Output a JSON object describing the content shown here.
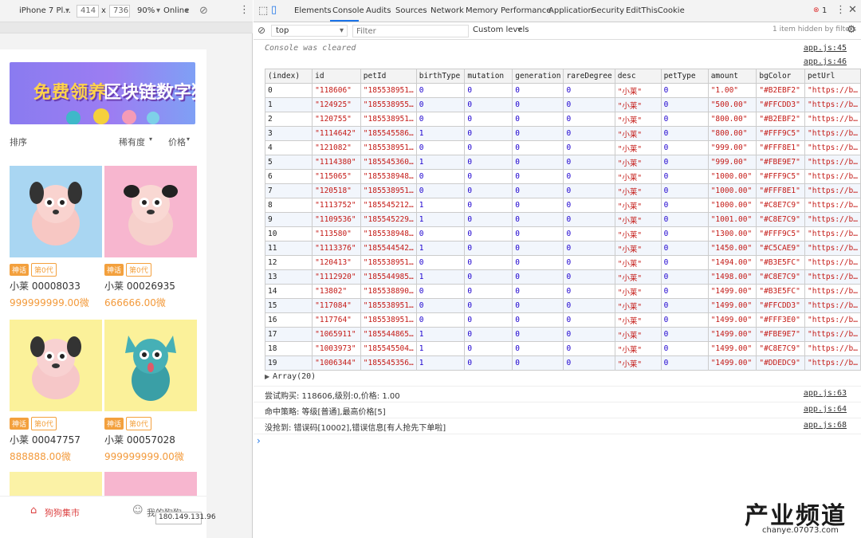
{
  "device_toolbar": {
    "device": "iPhone 7 Pl...",
    "width": "414",
    "x": "x",
    "height": "736",
    "zoom": "90%",
    "network": "Online"
  },
  "phone": {
    "banner": {
      "title_a": "免费领养",
      "title_b": "区块链数字狗"
    },
    "sort": {
      "label": "排序",
      "rarity": "稀有度",
      "price": "价格"
    },
    "cards": [
      {
        "tag1": "神话",
        "tag2": "第0代",
        "name": "小莱 00008033",
        "price": "999999999.00微",
        "bg": "#a9d6f2"
      },
      {
        "tag1": "神话",
        "tag2": "第0代",
        "name": "小莱 00026935",
        "price": "666666.00微",
        "bg": "#f7b6cf"
      },
      {
        "tag1": "神话",
        "tag2": "第0代",
        "name": "小莱 00047757",
        "price": "888888.00微",
        "bg": "#fbf19a"
      },
      {
        "tag1": "神话",
        "tag2": "第0代",
        "name": "小莱 00057028",
        "price": "999999999.00微",
        "bg": "#fbf19a"
      }
    ],
    "partial_bgs": [
      "#fbf2a6",
      "#f7b6cf"
    ],
    "nav": {
      "market": "狗狗集市",
      "mine": "我的狗狗"
    },
    "ip": "180.149.131.96"
  },
  "devtools": {
    "tabs": [
      "Elements",
      "Console",
      "Audits",
      "Sources",
      "Network",
      "Memory",
      "Performance",
      "Application",
      "Security",
      "EditThisCookie"
    ],
    "active_tab": "Console",
    "error_count": "1",
    "filter": {
      "context": "top",
      "placeholder": "Filter",
      "levels": "Custom levels",
      "hidden": "1 item hidden by filters"
    },
    "cleared": "Console was cleared",
    "cleared_src": "app.js:45",
    "table_src": "app.js:46",
    "columns": [
      "(index)",
      "id",
      "petId",
      "birthType",
      "mutation",
      "generation",
      "rareDegree",
      "desc",
      "petType",
      "amount",
      "bgColor",
      "petUrl"
    ],
    "rows": [
      [
        "0",
        "\"118606\"",
        "\"185538951…",
        "0",
        "0",
        "0",
        "0",
        "\"小莱\"",
        "0",
        "\"1.00\"",
        "\"#B2EBF2\"",
        "\"https://b…"
      ],
      [
        "1",
        "\"124925\"",
        "\"185538955…",
        "0",
        "0",
        "0",
        "0",
        "\"小莱\"",
        "0",
        "\"500.00\"",
        "\"#FFCDD3\"",
        "\"https://b…"
      ],
      [
        "2",
        "\"120755\"",
        "\"185538951…",
        "0",
        "0",
        "0",
        "0",
        "\"小莱\"",
        "0",
        "\"800.00\"",
        "\"#B2EBF2\"",
        "\"https://b…"
      ],
      [
        "3",
        "\"1114642\"",
        "\"185545586…",
        "1",
        "0",
        "0",
        "0",
        "\"小莱\"",
        "0",
        "\"800.00\"",
        "\"#FFF9C5\"",
        "\"https://b…"
      ],
      [
        "4",
        "\"121082\"",
        "\"185538951…",
        "0",
        "0",
        "0",
        "0",
        "\"小莱\"",
        "0",
        "\"999.00\"",
        "\"#FFF8E1\"",
        "\"https://b…"
      ],
      [
        "5",
        "\"1114380\"",
        "\"185545360…",
        "1",
        "0",
        "0",
        "0",
        "\"小莱\"",
        "0",
        "\"999.00\"",
        "\"#FBE9E7\"",
        "\"https://b…"
      ],
      [
        "6",
        "\"115065\"",
        "\"185538948…",
        "0",
        "0",
        "0",
        "0",
        "\"小莱\"",
        "0",
        "\"1000.00\"",
        "\"#FFF9C5\"",
        "\"https://b…"
      ],
      [
        "7",
        "\"120518\"",
        "\"185538951…",
        "0",
        "0",
        "0",
        "0",
        "\"小莱\"",
        "0",
        "\"1000.00\"",
        "\"#FFF8E1\"",
        "\"https://b…"
      ],
      [
        "8",
        "\"1113752\"",
        "\"185545212…",
        "1",
        "0",
        "0",
        "0",
        "\"小莱\"",
        "0",
        "\"1000.00\"",
        "\"#C8E7C9\"",
        "\"https://b…"
      ],
      [
        "9",
        "\"1109536\"",
        "\"185545229…",
        "1",
        "0",
        "0",
        "0",
        "\"小莱\"",
        "0",
        "\"1001.00\"",
        "\"#C8E7C9\"",
        "\"https://b…"
      ],
      [
        "10",
        "\"113580\"",
        "\"185538948…",
        "0",
        "0",
        "0",
        "0",
        "\"小莱\"",
        "0",
        "\"1300.00\"",
        "\"#FFF9C5\"",
        "\"https://b…"
      ],
      [
        "11",
        "\"1113376\"",
        "\"185544542…",
        "1",
        "0",
        "0",
        "0",
        "\"小莱\"",
        "0",
        "\"1450.00\"",
        "\"#C5CAE9\"",
        "\"https://b…"
      ],
      [
        "12",
        "\"120413\"",
        "\"185538951…",
        "0",
        "0",
        "0",
        "0",
        "\"小莱\"",
        "0",
        "\"1494.00\"",
        "\"#B3E5FC\"",
        "\"https://b…"
      ],
      [
        "13",
        "\"1112920\"",
        "\"185544985…",
        "1",
        "0",
        "0",
        "0",
        "\"小莱\"",
        "0",
        "\"1498.00\"",
        "\"#C8E7C9\"",
        "\"https://b…"
      ],
      [
        "14",
        "\"13802\"",
        "\"185538890…",
        "0",
        "0",
        "0",
        "0",
        "\"小莱\"",
        "0",
        "\"1499.00\"",
        "\"#B3E5FC\"",
        "\"https://b…"
      ],
      [
        "15",
        "\"117084\"",
        "\"185538951…",
        "0",
        "0",
        "0",
        "0",
        "\"小莱\"",
        "0",
        "\"1499.00\"",
        "\"#FFCDD3\"",
        "\"https://b…"
      ],
      [
        "16",
        "\"117764\"",
        "\"185538951…",
        "0",
        "0",
        "0",
        "0",
        "\"小莱\"",
        "0",
        "\"1499.00\"",
        "\"#FFF3E0\"",
        "\"https://b…"
      ],
      [
        "17",
        "\"1065911\"",
        "\"185544865…",
        "1",
        "0",
        "0",
        "0",
        "\"小莱\"",
        "0",
        "\"1499.00\"",
        "\"#FBE9E7\"",
        "\"https://b…"
      ],
      [
        "18",
        "\"1003973\"",
        "\"185545504…",
        "1",
        "0",
        "0",
        "0",
        "\"小莱\"",
        "0",
        "\"1499.00\"",
        "\"#C8E7C9\"",
        "\"https://b…"
      ],
      [
        "19",
        "\"1006344\"",
        "\"185545356…",
        "1",
        "0",
        "0",
        "0",
        "\"小莱\"",
        "0",
        "\"1499.00\"",
        "\"#DDEDC9\"",
        "\"https://b…"
      ]
    ],
    "array_label": "Array(20)",
    "logs": [
      {
        "text": "尝试购买: 118606,级别:0,价格: 1.00",
        "src": "app.js:63"
      },
      {
        "text": "命中策略: 等级[普通],最高价格[5]",
        "src": "app.js:64"
      },
      {
        "text": "没抢到: 错误码[10002],错误信息[有人抢先下单啦]",
        "src": "app.js:68"
      }
    ],
    "prompt": "›"
  },
  "watermark": {
    "title": "产业频道",
    "url": "chanye.07073.com"
  }
}
